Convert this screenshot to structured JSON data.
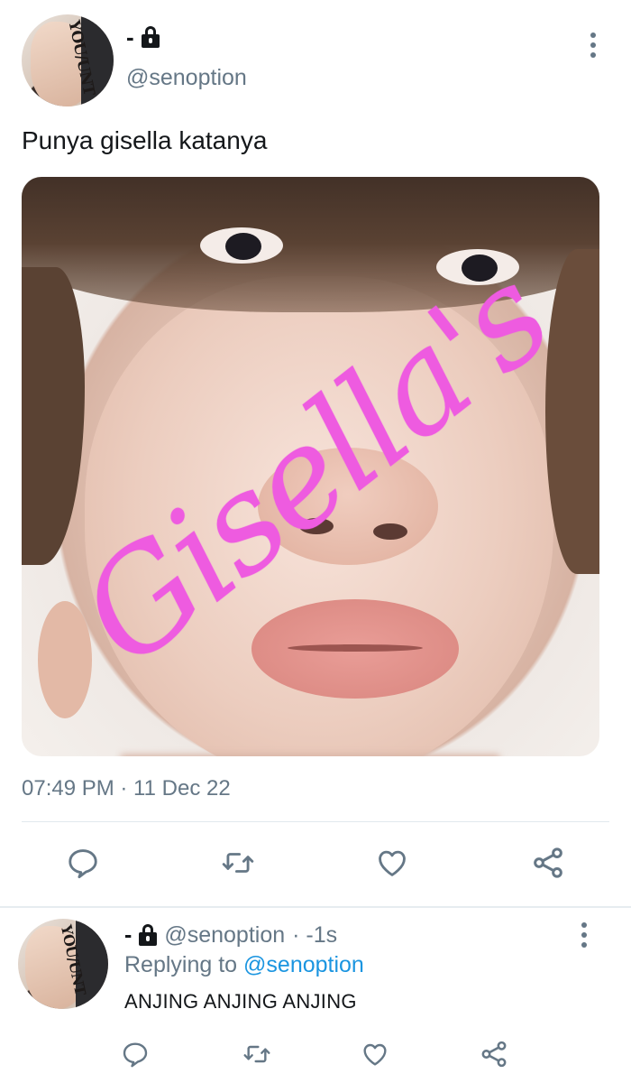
{
  "tweet": {
    "display_name": "-",
    "handle": "@senoption",
    "text": "Punya gisella katanya",
    "image_overlay_text": "Gisella's",
    "timestamp": "07:49 PM · 11 Dec 22",
    "avatar_tattoo": "YOU/UNT"
  },
  "reply": {
    "display_name": "-",
    "handle": "@senoption",
    "time": "· -1s",
    "replying_prefix": "Replying to",
    "replying_to": "@senoption",
    "text": "ANJING ANJING ANJING",
    "avatar_tattoo": "YOU/UNT"
  },
  "actions": [
    "reply-icon",
    "retweet-icon",
    "like-icon",
    "share-icon"
  ],
  "colors": {
    "text": "#14171a",
    "muted": "#657786",
    "link": "#1b95e0",
    "divider": "#e1e8ed",
    "signature": "#ee5be0"
  }
}
